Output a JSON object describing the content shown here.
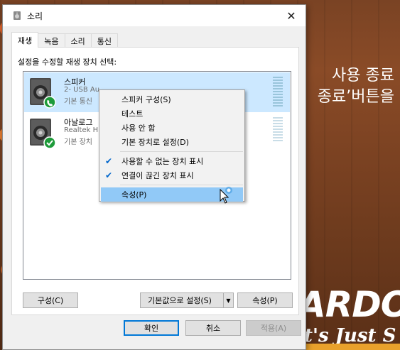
{
  "background": {
    "line1": "사용 종료",
    "line2": "종료’버튼을",
    "brand": "ARDO",
    "tagline": "t's Just S"
  },
  "dialog": {
    "title": "소리",
    "tabs": [
      {
        "label": "재생",
        "active": true
      },
      {
        "label": "녹음"
      },
      {
        "label": "소리"
      },
      {
        "label": "통신"
      }
    ],
    "panel_label": "설정을 수정할 재생 장치 선택:",
    "devices": [
      {
        "name": "스피커",
        "line2": "2- USB Au",
        "line3": "기본 통신"
      },
      {
        "name": "아날로그",
        "line2": "Realtek Hi",
        "line3": "기본 장치"
      }
    ],
    "buttons": {
      "configure": "구성(C)",
      "set_default": "기본값으로 설정(S)",
      "properties": "속성(P)",
      "ok": "확인",
      "cancel": "취소",
      "apply": "적용(A)"
    }
  },
  "context_menu": {
    "items": [
      {
        "label": "스피커 구성(S)"
      },
      {
        "label": "테스트"
      },
      {
        "label": "사용 안 함"
      },
      {
        "label": "기본 장치로 설정(D)"
      },
      {
        "label": "사용할 수 없는 장치 표시",
        "checked": true
      },
      {
        "label": "연결이 끊긴 장치 표시",
        "checked": true
      },
      {
        "label": "속성(P)",
        "highlighted": true
      }
    ]
  },
  "colors": {
    "selection": "#cce8ff",
    "menu_hover": "#91c9f7",
    "default_badge": "#1e9b3a",
    "accent": "#0078d7"
  }
}
